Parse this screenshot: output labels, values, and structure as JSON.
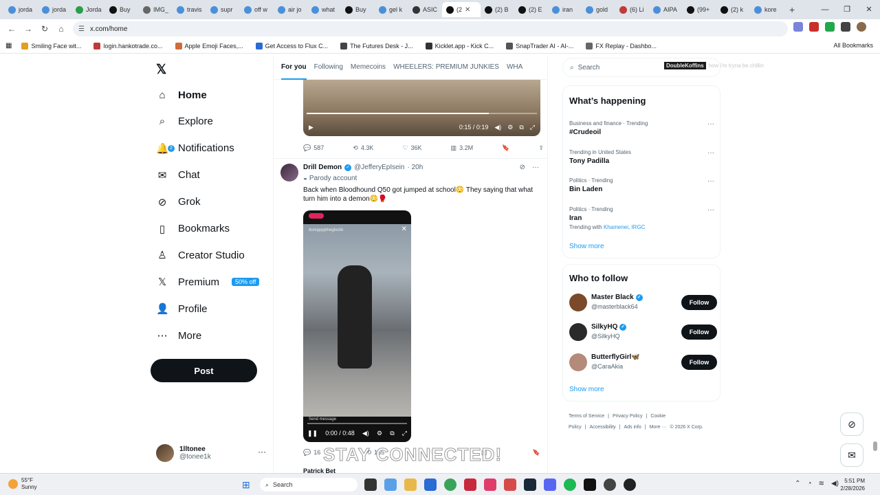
{
  "browser": {
    "tabs": [
      {
        "label": "jorda"
      },
      {
        "label": "jorda"
      },
      {
        "label": "Jorda"
      },
      {
        "label": "Buy"
      },
      {
        "label": "IMG_"
      },
      {
        "label": "travis"
      },
      {
        "label": "supr"
      },
      {
        "label": "off w"
      },
      {
        "label": "air jo"
      },
      {
        "label": "what"
      },
      {
        "label": "Buy"
      },
      {
        "label": "gel k"
      },
      {
        "label": "ASIC"
      },
      {
        "label": "(2"
      },
      {
        "label": "(2) B"
      },
      {
        "label": "(2) E"
      },
      {
        "label": "iran"
      },
      {
        "label": "gold"
      },
      {
        "label": "(6) Li"
      },
      {
        "label": "AIPA"
      },
      {
        "label": "(99+"
      },
      {
        "label": "(2) k"
      },
      {
        "label": "kore"
      }
    ],
    "new_tab": "+",
    "url": "x.com/home",
    "bookmarks": [
      {
        "label": "Smiling Face wit..."
      },
      {
        "label": "login.hankotrade.co..."
      },
      {
        "label": "Apple Emoji Faces,..."
      },
      {
        "label": "Get Access to Flux C..."
      },
      {
        "label": "The Futures Desk - J..."
      },
      {
        "label": "Kicklet.app - Kick C..."
      },
      {
        "label": "SnapTrader AI - AI-..."
      },
      {
        "label": "FX Replay - Dashbo..."
      }
    ],
    "all_bookmarks": "All Bookmarks"
  },
  "sidebar": {
    "items": [
      {
        "label": "Home",
        "icon": "home-icon"
      },
      {
        "label": "Explore",
        "icon": "search-icon"
      },
      {
        "label": "Notifications",
        "icon": "bell-icon",
        "badge": "2"
      },
      {
        "label": "Chat",
        "icon": "mail-icon"
      },
      {
        "label": "Grok",
        "icon": "grok-icon"
      },
      {
        "label": "Bookmarks",
        "icon": "bookmark-icon"
      },
      {
        "label": "Creator Studio",
        "icon": "creator-icon"
      },
      {
        "label": "Premium",
        "icon": "x-icon",
        "tag": "50% off"
      },
      {
        "label": "Profile",
        "icon": "person-icon"
      },
      {
        "label": "More",
        "icon": "more-icon"
      }
    ],
    "post_label": "Post",
    "user": {
      "name": "1lltonee",
      "handle": "@tonee1k"
    }
  },
  "feed": {
    "tabs": [
      "For you",
      "Following",
      "Memecoins",
      "WHEELERS: PREMIUM JUNKIES",
      "WHA"
    ],
    "video1": {
      "time": "0:15 / 0:19",
      "progress": 0.79
    },
    "actions1": {
      "replies": "587",
      "reposts": "4.3K",
      "likes": "36K",
      "views": "3.2M"
    },
    "tweet": {
      "name": "Drill Demon",
      "handle": "@JefferyEpIsein",
      "time": "· 20h",
      "parody": "Parody account",
      "text": "Back when Bloodhound Q50 got jumped at school😳 They saying that what turn him into a demon😳🥊",
      "video": {
        "time": "0:00 / 0:48",
        "top_label": "dumpppptheglockk",
        "bottom_label": "Send message",
        "progress": 0.0
      }
    },
    "actions2": {
      "replies": "16",
      "reposts": "155"
    },
    "next_author": "Patrick Bet"
  },
  "right": {
    "search_placeholder": "Search",
    "overlay": {
      "tag": "DoubleKoffins",
      "text": "how i'm tryna be chillin"
    },
    "whats_happening": {
      "title": "What’s happening",
      "trends": [
        {
          "meta": "Business and finance · Trending",
          "topic": "#Crudeoil"
        },
        {
          "meta": "Trending in United States",
          "topic": "Tony Padilla"
        },
        {
          "meta": "Politics · Trending",
          "topic": "Bin Laden"
        },
        {
          "meta": "Politics · Trending",
          "topic": "Iran",
          "with_label": "Trending with",
          "with_items": "Khamenei, IRGC"
        }
      ],
      "show_more": "Show more"
    },
    "who_to_follow": {
      "title": "Who to follow",
      "users": [
        {
          "name": "Master Black",
          "handle": "@masterblack64",
          "verified": true,
          "color": "#7a4a2a"
        },
        {
          "name": "SilkyHQ",
          "handle": "@SilkyHQ",
          "verified": true,
          "color": "#2a2a2a"
        },
        {
          "name": "ButterflyGirl🦋",
          "handle": "@CaraAkia",
          "verified": false,
          "color": "#b48a7a"
        }
      ],
      "follow_label": "Follow",
      "show_more": "Show more"
    },
    "footer": [
      "Terms of Service",
      "|",
      "Privacy Policy",
      "|",
      "Cookie Policy",
      "|",
      "Accessibility",
      "|",
      "Ads info",
      "|",
      "More ···",
      "© 2026 X Corp."
    ]
  },
  "watermark": "STAY CONNECTED!",
  "taskbar": {
    "weather_temp": "55°F",
    "weather_cond": "Sunny",
    "search_label": "Search",
    "time": "5:51 PM",
    "date": "2/28/2026"
  },
  "colors": {
    "accent": "#1d9bf0",
    "text": "#0f1419",
    "muted": "#536471"
  }
}
